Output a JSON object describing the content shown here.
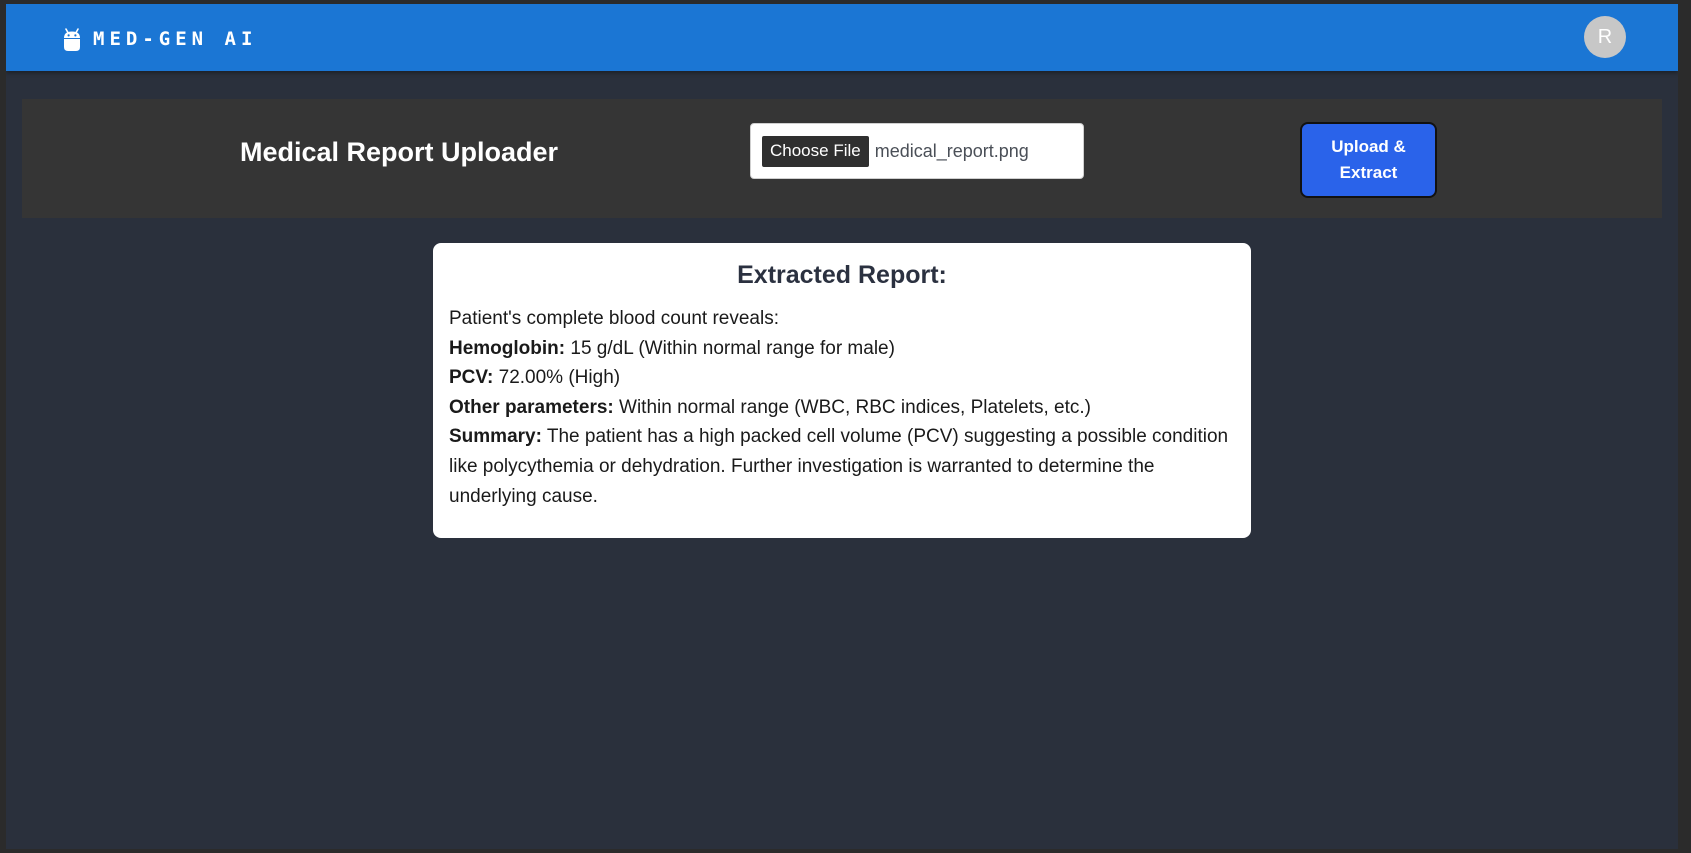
{
  "app": {
    "brand": "MED-GEN AI",
    "brand_icon": "android-icon",
    "avatar_initial": "R"
  },
  "colors": {
    "navbar": "#1b76d4",
    "background": "#2a303c",
    "panel": "#353535",
    "primary_button": "#2a63ea",
    "card": "#ffffff"
  },
  "uploader": {
    "title": "Medical Report Uploader",
    "choose_file_label": "Choose File",
    "selected_file": "medical_report.png",
    "upload_button_label": "Upload & Extract"
  },
  "report": {
    "heading": "Extracted Report:",
    "intro": "Patient's complete blood count reveals:",
    "lines": [
      {
        "label": "Hemoglobin:",
        "text": " 15 g/dL (Within normal range for male)"
      },
      {
        "label": "PCV:",
        "text": " 72.00% (High)"
      },
      {
        "label": "Other parameters:",
        "text": " Within normal range (WBC, RBC indices, Platelets, etc.)"
      },
      {
        "label": "Summary:",
        "text": " The patient has a high packed cell volume (PCV) suggesting a possible condition like polycythemia or dehydration. Further investigation is warranted to determine the underlying cause."
      }
    ]
  }
}
